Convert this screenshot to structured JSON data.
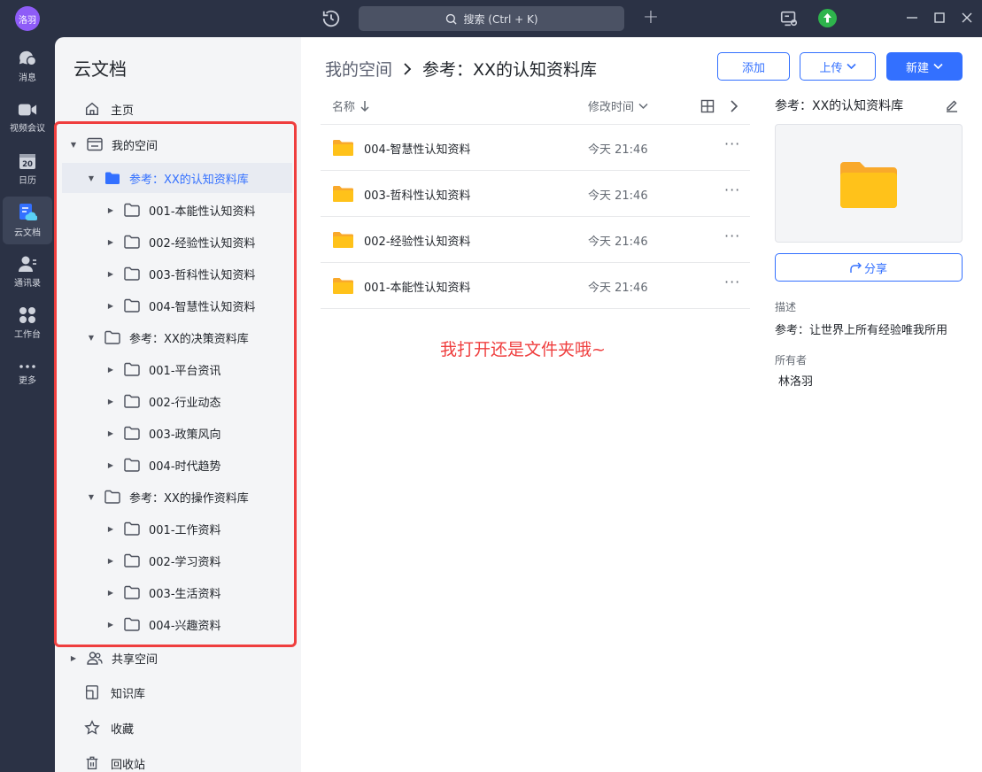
{
  "titlebar": {
    "avatar_text": "洛羽",
    "search_label": "搜索 (Ctrl + K)",
    "plus": "+"
  },
  "rail": {
    "items": [
      {
        "label": "消息",
        "icon": "message-icon"
      },
      {
        "label": "视频会议",
        "icon": "video-icon"
      },
      {
        "label": "日历",
        "icon": "calendar-icon",
        "day": "20"
      },
      {
        "label": "云文档",
        "icon": "cloud-doc-icon",
        "active": true
      },
      {
        "label": "通讯录",
        "icon": "contacts-icon"
      },
      {
        "label": "工作台",
        "icon": "workbench-icon"
      },
      {
        "label": "更多",
        "icon": "more-icon"
      }
    ]
  },
  "tree": {
    "title": "云文档",
    "home": "主页",
    "my_space": "我的空间",
    "libraries": [
      {
        "name": "参考：XX的认知资料库",
        "children": [
          "001-本能性认知资料",
          "002-经验性认知资料",
          "003-哲科性认知资料",
          "004-智慧性认知资料"
        ]
      },
      {
        "name": "参考：XX的决策资料库",
        "children": [
          "001-平台资讯",
          "002-行业动态",
          "003-政策风向",
          "004-时代趋势"
        ]
      },
      {
        "name": "参考：XX的操作资料库",
        "children": [
          "001-工作资料",
          "002-学习资料",
          "003-生活资料",
          "004-兴趣资料"
        ]
      }
    ],
    "shared": "共享空间",
    "knowledge": "知识库",
    "favorites": "收藏",
    "trash": "回收站"
  },
  "main": {
    "breadcrumb": [
      "我的空间",
      "参考：XX的认知资料库"
    ],
    "add_label": "添加",
    "upload_label": "上传",
    "create_label": "新建",
    "col_name": "名称",
    "col_modified": "修改时间",
    "files": [
      {
        "name": "004-智慧性认知资料",
        "time": "今天 21:46"
      },
      {
        "name": "003-哲科性认知资料",
        "time": "今天 21:46"
      },
      {
        "name": "002-经验性认知资料",
        "time": "今天 21:46"
      },
      {
        "name": "001-本能性认知资料",
        "time": "今天 21:46"
      }
    ],
    "annotation": "我打开还是文件夹哦~"
  },
  "detail": {
    "title": "参考：XX的认知资料库",
    "share_label": "分享",
    "desc_label": "描述",
    "desc_value": "参考：让世界上所有经验唯我所用",
    "owner_label": "所有者",
    "owner_value": "林洛羽"
  },
  "colors": {
    "accent": "#3370ff",
    "folder": "#ffc21a",
    "annotation": "#ef3e3e",
    "chrome": "#2b3245"
  }
}
